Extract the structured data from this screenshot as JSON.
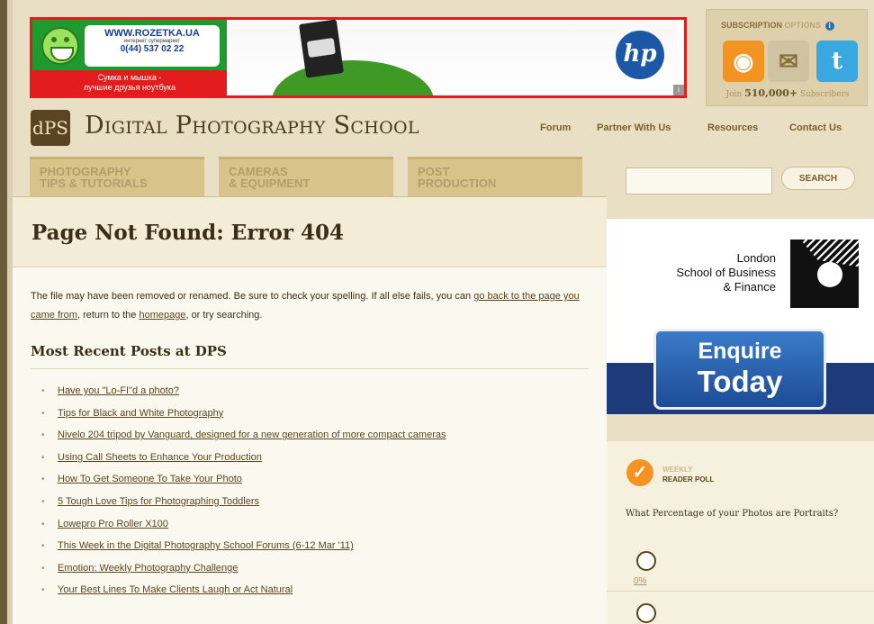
{
  "banner": {
    "url": "WWW.ROZETKA.UA",
    "subtitle": "интернет супермаркет",
    "phone": "0(44) 537 02 22",
    "slogan_line1": "Сумка и мышка -",
    "slogan_line2": "лучшие друзья ноутбука",
    "hp_logo": "hp"
  },
  "subscription": {
    "title": "SUBSCRIPTION",
    "options": "OPTIONS",
    "icons": [
      "rss-icon",
      "email-icon",
      "twitter-icon"
    ],
    "count_prefix": "Join",
    "count": "510,000+",
    "count_suffix": "Subscribers"
  },
  "site": {
    "logo_mark": "dPS",
    "name": "Digital Photography School"
  },
  "top_nav": [
    "Forum",
    "Partner With Us",
    "Resources",
    "Contact Us"
  ],
  "categories": [
    {
      "line1": "PHOTOGRAPHY",
      "line2": "TIPS & TUTORIALS"
    },
    {
      "line1": "CAMERAS",
      "line2": "& EQUIPMENT"
    },
    {
      "line1": "POST",
      "line2": "PRODUCTION"
    }
  ],
  "search": {
    "value": "",
    "button": "SEARCH"
  },
  "main": {
    "title": "Page Not Found: Error 404",
    "intro_1": "The file may have been removed or renamed. Be sure to check your spelling. If all else fails, you can ",
    "link_back": "go back to the page you came from",
    "intro_2": ", return to the ",
    "link_home": "homepage",
    "intro_3": ", or try searching.",
    "recent_title": "Most Recent Posts at DPS",
    "posts": [
      "Have you \"Lo-FI\"d a photo?",
      "Tips for Black and White Photography",
      "Nivelo 204 tripod by Vanguard, designed for a new generation of more compact cameras",
      "Using Call Sheets to Enhance Your Production",
      "How To Get Someone To Take Your Photo",
      "5 Tough Love Tips for Photographing Toddlers",
      "Lowepro Pro Roller X100",
      "This Week in the Digital Photography School Forums (6-12 Mar '11)",
      "Emotion: Weekly Photography Challenge",
      "Your Best Lines To Make Clients Laugh or Act Natural"
    ]
  },
  "side_ad": {
    "line1": "London",
    "line2": "School of Business",
    "line3": "& Finance",
    "cta_1": "Enquire",
    "cta_2": "Today"
  },
  "poll": {
    "label_1": "WEEKLY",
    "label_2": "READER POLL",
    "question": "What Percentage of your Photos are Portraits?",
    "first_option": "0%"
  },
  "colors": {
    "background": "#e9dfc4",
    "banner_border": "#e31d1d",
    "accent_brown": "#5b4520",
    "enquire_blue": "#1d4c96",
    "rss_orange": "#f39322"
  }
}
